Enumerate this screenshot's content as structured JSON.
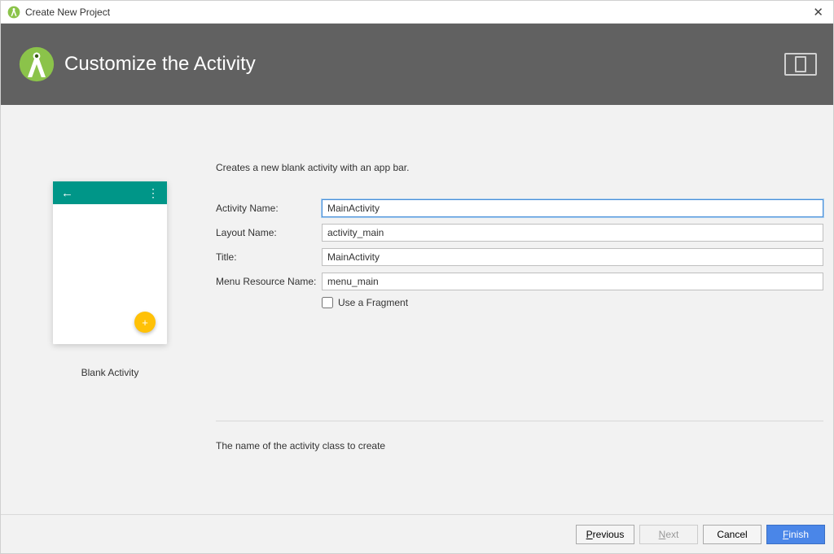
{
  "window": {
    "title": "Create New Project"
  },
  "header": {
    "title": "Customize the Activity"
  },
  "preview": {
    "label": "Blank Activity"
  },
  "form": {
    "description": "Creates a new blank activity with an app bar.",
    "activity_name_label": "Activity Name:",
    "activity_name_value": "MainActivity",
    "layout_name_label": "Layout Name:",
    "layout_name_value": "activity_main",
    "title_label": "Title:",
    "title_value": "MainActivity",
    "menu_resource_label": "Menu Resource Name:",
    "menu_resource_value": "menu_main",
    "use_fragment_label": "Use a Fragment",
    "use_fragment_checked": false
  },
  "hint": "The name of the activity class to create",
  "buttons": {
    "previous": "Previous",
    "next": "Next",
    "cancel": "Cancel",
    "finish": "Finish"
  }
}
